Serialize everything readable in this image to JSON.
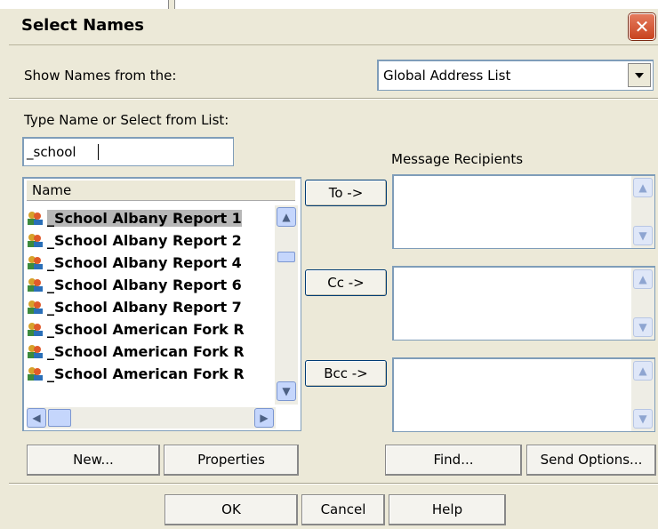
{
  "dialog": {
    "title": "Select Names",
    "close_symbol": "✕"
  },
  "show_names": {
    "label": "Show Names from the:",
    "selected": "Global Address List"
  },
  "type_name": {
    "label": "Type Name or Select from List:",
    "value": "_school"
  },
  "name_list": {
    "header": "Name",
    "items": [
      "_School Albany Report 1",
      "_School Albany Report 2",
      "_School Albany Report 4",
      "_School Albany Report 6",
      "_School Albany Report 7",
      "_School American Fork R",
      "_School American Fork R",
      "_School American Fork R"
    ],
    "selected_index": 0
  },
  "recipients": {
    "label": "Message Recipients",
    "to_button": "To ->",
    "cc_button": "Cc ->",
    "bcc_button": "Bcc ->"
  },
  "buttons": {
    "new": "New...",
    "properties": "Properties",
    "find": "Find...",
    "send_options": "Send Options...",
    "ok": "OK",
    "cancel": "Cancel",
    "help": "Help"
  },
  "icons": {
    "contact": "contact-group-icon",
    "close": "close-icon",
    "dropdown": "chevron-down-icon"
  }
}
